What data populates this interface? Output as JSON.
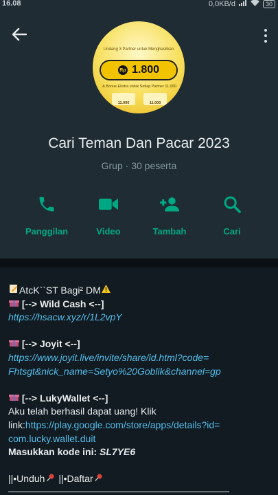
{
  "status_bar": {
    "time": "16.08",
    "speed": "0,0KB/d",
    "battery": "30"
  },
  "header": {
    "group_name": "Cari Teman Dan Pacar 2023",
    "group_type": "Grup",
    "members": "30 peserta",
    "avatar": {
      "top_text": "Undang 3 Partner untuk Menghasilkan",
      "currency": "Rp",
      "amount": "1.800",
      "bonus_text": "& Bonus Ekstra untuk Setiap Partner",
      "bonus_amount": "11.000",
      "chips": [
        "11.000",
        "11.000"
      ]
    }
  },
  "actions": [
    {
      "label": "Panggilan",
      "icon": "phone-icon"
    },
    {
      "label": "Video",
      "icon": "video-camera-icon"
    },
    {
      "label": "Tambah",
      "icon": "add-person-icon"
    },
    {
      "label": "Cari",
      "icon": "search-icon"
    }
  ],
  "description": {
    "line1": "AtcK``ST Bagi² DM",
    "wild_cash_heading": "[--> Wild Cash <--]",
    "wild_cash_link": "https://hsacw.xyz/r/1L2vpY",
    "joyit_heading": "[--> Joyit <--]",
    "joyit_link_1": "https://www.joyit.live/invite/share/id.html?code=",
    "joyit_link_2": "Fhtsgt&nick_name=Setyo%20Goblik&channel=gp",
    "lucky_heading": "[--> LukyWallet <--]",
    "lucky_text": "Aku telah berhasil dapat uang! Klik",
    "lucky_link_prefix": "link:",
    "lucky_link_1": "https://play.google.com/store/apps/details?id=",
    "lucky_link_2": "com.lucky.wallet.duit",
    "code_label": "Masukkan kode ini:",
    "code": "SL7YE6",
    "unduh": "||•Unduh",
    "daftar": "||•Daftar"
  },
  "colors": {
    "accent": "#00a884",
    "link": "#53bdeb",
    "header_bg": "#1f2c33",
    "description_bg": "#111b21"
  }
}
